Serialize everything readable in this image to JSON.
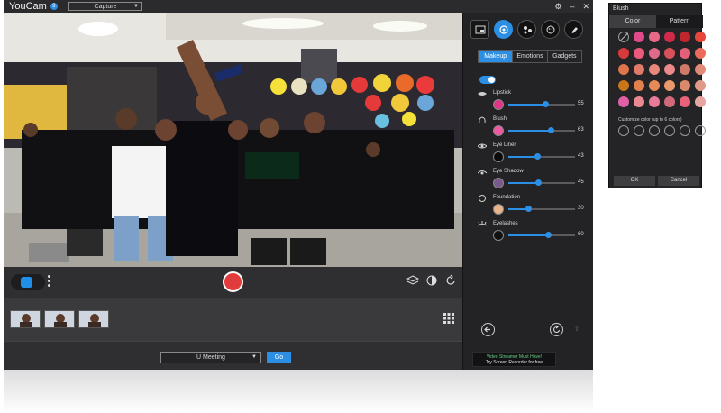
{
  "app": {
    "title": "YouCam",
    "version_badge": "9",
    "mode_selected": "Capture",
    "controls": [
      "settings-icon",
      "minimize-icon",
      "close-icon"
    ]
  },
  "capture_bar": {
    "record_color": "#e23b3b",
    "icons": [
      "layers-icon",
      "face-effect-icon",
      "undo-icon"
    ]
  },
  "thumbnails": {
    "count": 3,
    "grid_icon": "grid-icon"
  },
  "meeting": {
    "selected": "U Meeting",
    "go_label": "Go"
  },
  "panel": {
    "tools": [
      "frame-icon",
      "makeup-icon",
      "effects-icon",
      "emoticon-icon",
      "brush-icon"
    ],
    "tabs": [
      {
        "label": "Makeup",
        "active": true
      },
      {
        "label": "Emotions",
        "active": false
      },
      {
        "label": "Gadgets",
        "active": false
      }
    ],
    "toggle_on": true,
    "features": [
      {
        "label": "Lipstick",
        "value": "55",
        "level": 0.55,
        "swatch": "#e0368a"
      },
      {
        "label": "Blush",
        "value": "63",
        "level": 0.63,
        "swatch": "#ee5aa0"
      },
      {
        "label": "Eye Liner",
        "value": "43",
        "level": 0.43,
        "swatch": "#0a0a0a"
      },
      {
        "label": "Eye Shadow",
        "value": "45",
        "level": 0.45,
        "swatch": "#7a5a8a"
      },
      {
        "label": "Foundation",
        "value": "30",
        "level": 0.3,
        "swatch": "#e8b48a"
      },
      {
        "label": "Eyelashes",
        "value": "60",
        "level": 0.6,
        "swatch": "#111111"
      }
    ],
    "promo_line1": "Video Streamer Must Have!",
    "promo_line2": "Try Screen Recorder for free"
  },
  "brush": {
    "title": "Blush",
    "tabs": [
      {
        "label": "Color",
        "active": true
      },
      {
        "label": "Pattern",
        "active": false
      }
    ],
    "colors": [
      "none",
      "#e04a8a",
      "#e8688a",
      "#cf2a4a",
      "#c0262e",
      "#e8463a",
      "#d83a3a",
      "#ea5a7a",
      "#e06a8a",
      "#d8505a",
      "#e2607a",
      "#ec6a5a",
      "#e0744a",
      "#e27a6a",
      "#e8887a",
      "#ea8a8a",
      "#d07a6a",
      "#e28a78",
      "#c8761a",
      "#e28050",
      "#e68a58",
      "#ea9a6a",
      "#d88a6a",
      "#e09a8a",
      "#e060a8",
      "#e88890",
      "#e87a9a",
      "#d06a7a",
      "#e8627a",
      "#e8a4a0"
    ],
    "custom_label": "Customize color (up to 6 colors)",
    "custom_slots": 6,
    "ok_label": "OK",
    "cancel_label": "Cancel"
  }
}
